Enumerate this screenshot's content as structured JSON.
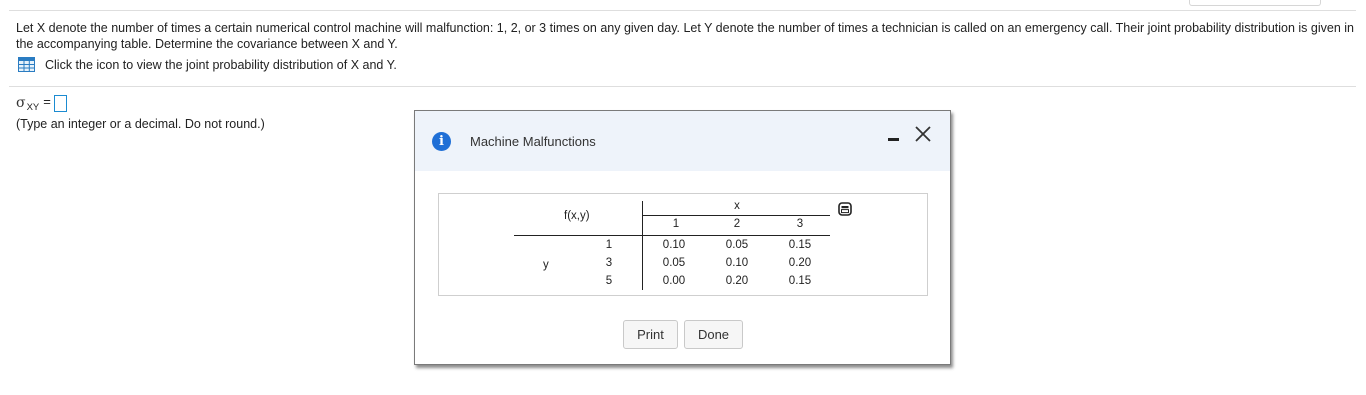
{
  "question": {
    "text": "Let X denote the number of times a certain numerical control machine will malfunction: 1, 2, or 3 times on any given day. Let Y denote the number of times a technician is called on an emergency call. Their joint probability distribution is given in the accompanying table. Determine the covariance between X and Y.",
    "table_link_text": "Click the icon to view the joint probability distribution of X and Y."
  },
  "answer": {
    "symbol": "σ",
    "subscript": "XY",
    "equals": "=",
    "value": "",
    "hint": "(Type an integer or a decimal. Do not round.)"
  },
  "modal": {
    "title": "Machine Malfunctions",
    "info_glyph": "i",
    "table": {
      "corner_label": "f(x,y)",
      "x_label": "x",
      "y_label": "y",
      "x_values": [
        "1",
        "2",
        "3"
      ],
      "y_values": [
        "1",
        "3",
        "5"
      ],
      "rows": [
        [
          "0.10",
          "0.05",
          "0.15"
        ],
        [
          "0.05",
          "0.10",
          "0.20"
        ],
        [
          "0.00",
          "0.20",
          "0.15"
        ]
      ]
    },
    "buttons": {
      "print": "Print",
      "done": "Done"
    }
  },
  "colors": {
    "accent_blue": "#1b8bd1",
    "info_blue": "#1f6fd6",
    "modal_header_bg": "#eef3fa"
  }
}
